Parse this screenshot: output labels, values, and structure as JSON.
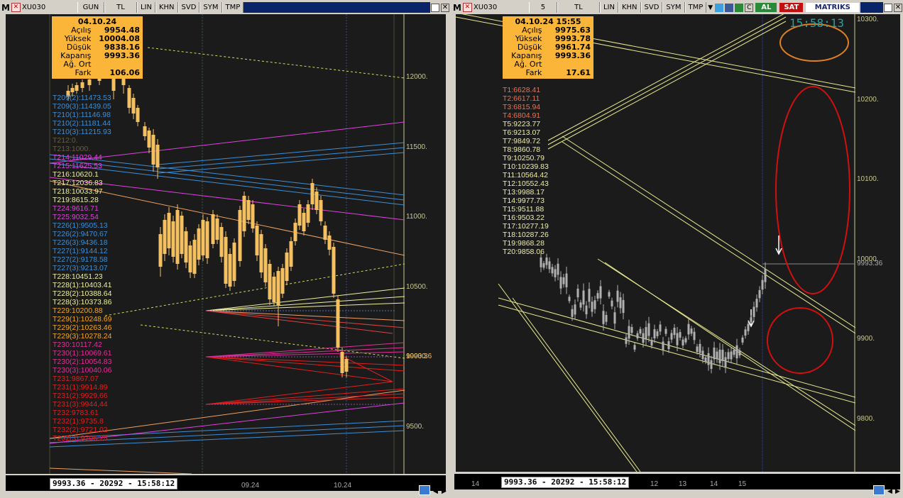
{
  "left": {
    "toolbar": {
      "symbol": "XU030",
      "period": "GUN",
      "currency": "TL",
      "buttons": [
        "LIN",
        "KHN",
        "SVD",
        "SYM",
        "TMP"
      ]
    },
    "info": {
      "date": "04.10.24",
      "rows": [
        {
          "label": "Açılış",
          "value": "9954.48"
        },
        {
          "label": "Yüksek",
          "value": "10004.08"
        },
        {
          "label": "Düşük",
          "value": "9838.16"
        },
        {
          "label": "Kapanış",
          "value": "9993.36"
        },
        {
          "label": "Ağ. Ort",
          "value": ""
        },
        {
          "label": "Fark",
          "value": "106.06"
        }
      ]
    },
    "levels": [
      {
        "t": "T209(2):11473.53",
        "c": "#3d8fd6"
      },
      {
        "t": "T209(3):11439.05",
        "c": "#3d8fd6"
      },
      {
        "t": "T210(1):11146.98",
        "c": "#3d8fd6"
      },
      {
        "t": "T210(2):11181.44",
        "c": "#3d8fd6"
      },
      {
        "t": "T210(3):11215.93",
        "c": "#3d8fd6"
      },
      {
        "t": "T212:0.",
        "c": "#6b5e3a"
      },
      {
        "t": "T213:1000.",
        "c": "#6b5e3a"
      },
      {
        "t": "T214:11029.44",
        "c": "#e040e0"
      },
      {
        "t": "T215:11625.53",
        "c": "#e040e0"
      },
      {
        "t": "T216:10620.1",
        "c": "#f0f0a0"
      },
      {
        "t": "T217:12036.83",
        "c": "#f0f0a0"
      },
      {
        "t": "T218:10033.97",
        "c": "#f0f0a0"
      },
      {
        "t": "T219:8615.28",
        "c": "#f0f0a0"
      },
      {
        "t": "T224:9616.71",
        "c": "#e040e0"
      },
      {
        "t": "T225:9032.54",
        "c": "#e040e0"
      },
      {
        "t": "T226(1):9505.13",
        "c": "#3d8fd6"
      },
      {
        "t": "T226(2):9470.67",
        "c": "#3d8fd6"
      },
      {
        "t": "T226(3):9436.18",
        "c": "#3d8fd6"
      },
      {
        "t": "T227(1):9144.12",
        "c": "#3d8fd6"
      },
      {
        "t": "T227(2):9178.58",
        "c": "#3d8fd6"
      },
      {
        "t": "T227(3):9213.07",
        "c": "#3d8fd6"
      },
      {
        "t": "T228:10451.23",
        "c": "#f0f0a0"
      },
      {
        "t": "T228(1):10403.41",
        "c": "#f0f0a0"
      },
      {
        "t": "T228(2):10388.64",
        "c": "#f0f0a0"
      },
      {
        "t": "T228(3):10373.86",
        "c": "#f0f0a0"
      },
      {
        "t": "T229:10200.88",
        "c": "#f5a623"
      },
      {
        "t": "T229(1):10248.69",
        "c": "#f5a623"
      },
      {
        "t": "T229(2):10263.46",
        "c": "#f5a623"
      },
      {
        "t": "T229(3):10278.24",
        "c": "#f5a623"
      },
      {
        "t": "T230:10117.42",
        "c": "#e0309a"
      },
      {
        "t": "T230(1):10069.61",
        "c": "#e0309a"
      },
      {
        "t": "T230(2):10054.83",
        "c": "#e0309a"
      },
      {
        "t": "T230(3):10040.06",
        "c": "#e0309a"
      },
      {
        "t": "T231:9867.07",
        "c": "#e02020"
      },
      {
        "t": "T231(1):9914.89",
        "c": "#e02020"
      },
      {
        "t": "T231(2):9929.66",
        "c": "#e02020"
      },
      {
        "t": "T231(3):9944.44",
        "c": "#e02020"
      },
      {
        "t": "T232:9783.61",
        "c": "#e02020"
      },
      {
        "t": "T232(1):9735.8",
        "c": "#e02020"
      },
      {
        "t": "T232(2):9721.02",
        "c": "#e02020"
      },
      {
        "t": "T232(3):9706.25",
        "c": "#e02020"
      }
    ],
    "yaxis": [
      "12000.",
      "11500.",
      "11000.",
      "10500.",
      "10000.",
      "9500."
    ],
    "last": "9993.36",
    "xaxis": [
      "09.24",
      "10.24"
    ],
    "status": "9993.36 - 20292 - 15:58:12"
  },
  "right": {
    "toolbar": {
      "symbol": "XU030",
      "period": "5",
      "currency": "TL",
      "buttons": [
        "LIN",
        "KHN",
        "SVD",
        "SYM",
        "TMP"
      ],
      "buy": "AL",
      "sell": "SAT",
      "brand": "MATRIKS"
    },
    "clock": "15:58:13",
    "info": {
      "date": "04.10.24 15:55",
      "rows": [
        {
          "label": "Açılış",
          "value": "9975.63"
        },
        {
          "label": "Yüksek",
          "value": "9993.78"
        },
        {
          "label": "Düşük",
          "value": "9961.74"
        },
        {
          "label": "Kapanış",
          "value": "9993.36"
        },
        {
          "label": "Ağ. Ort",
          "value": ""
        },
        {
          "label": "Fark",
          "value": "17.61"
        }
      ]
    },
    "levels": [
      {
        "t": "T1:6628.41",
        "c": "#f07050"
      },
      {
        "t": "T2:6617.11",
        "c": "#f07050"
      },
      {
        "t": "T3:6815.94",
        "c": "#f07050"
      },
      {
        "t": "T4:6804.91",
        "c": "#f07050"
      },
      {
        "t": "T5:9223.77",
        "c": "#f0f0a0"
      },
      {
        "t": "T6:9213.07",
        "c": "#f0f0a0"
      },
      {
        "t": "T7:9849.72",
        "c": "#f0f0a0"
      },
      {
        "t": "T8:9860.78",
        "c": "#f0f0a0"
      },
      {
        "t": "T9:10250.79",
        "c": "#f0f0a0"
      },
      {
        "t": "T10:10239.83",
        "c": "#f0f0a0"
      },
      {
        "t": "T11:10564.42",
        "c": "#f0f0a0"
      },
      {
        "t": "T12:10552.43",
        "c": "#f0f0a0"
      },
      {
        "t": "T13:9988.17",
        "c": "#f0f0a0"
      },
      {
        "t": "T14:9977.73",
        "c": "#f0f0a0"
      },
      {
        "t": "T15:9511.88",
        "c": "#f0f0a0"
      },
      {
        "t": "T16:9503.22",
        "c": "#f0f0a0"
      },
      {
        "t": "T17:10277.19",
        "c": "#f0f0a0"
      },
      {
        "t": "T18:10287.26",
        "c": "#f0f0a0"
      },
      {
        "t": "T19:9868.28",
        "c": "#f0f0a0"
      },
      {
        "t": "T20:9858.06",
        "c": "#f0f0a0"
      }
    ],
    "yaxis": [
      "10300.",
      "10200.",
      "10100.",
      "10000.",
      "9900.",
      "9800."
    ],
    "last": "9993.36",
    "xaxis": [
      "14",
      "12",
      "13",
      "14",
      "15"
    ],
    "status": "9993.36 - 20292 - 15:58:12"
  }
}
